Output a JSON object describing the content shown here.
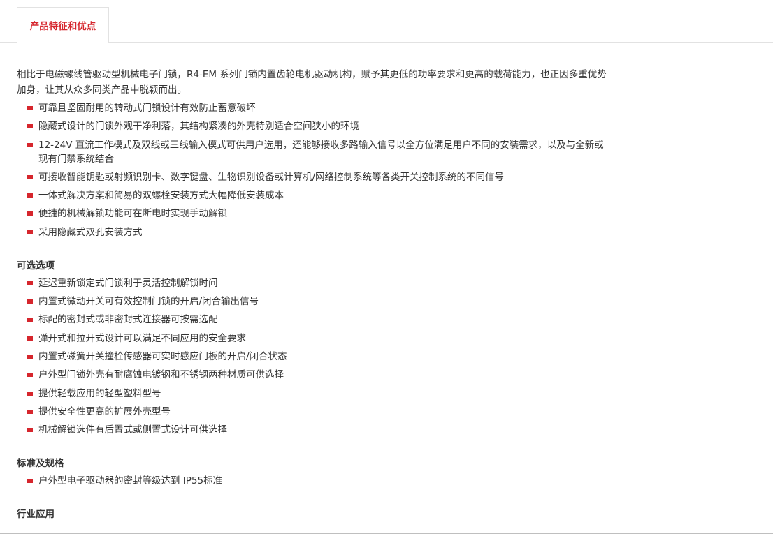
{
  "tabs": [
    {
      "label": "产品特征和优点"
    }
  ],
  "intro": "相比于电磁螺线管驱动型机械电子门锁，R4-EM 系列门锁内置齿轮电机驱动机构，赋予其更低的功率要求和更高的载荷能力，也正因多重优势加身，让其从众多同类产品中脱颖而出。",
  "features": [
    "可靠且坚固耐用的转动式门锁设计有效防止蓄意破坏",
    "隐藏式设计的门锁外观干净利落，其结构紧凑的外壳特别适合空间狭小的环境",
    "12-24V 直流工作模式及双线或三线输入模式可供用户选用，还能够接收多路输入信号以全方位满足用户不同的安装需求，以及与全新或现有门禁系统结合",
    "可接收智能钥匙或射频识别卡、数字键盘、生物识别设备或计算机/网络控制系统等各类开关控制系统的不同信号",
    "一体式解决方案和简易的双螺栓安装方式大幅降低安装成本",
    "便捷的机械解锁功能可在断电时实现手动解锁",
    "采用隐藏式双孔安装方式"
  ],
  "options": {
    "heading": "可选选项",
    "items": [
      "延迟重新锁定式门锁利于灵活控制解锁时间",
      "内置式微动开关可有效控制门锁的开启/闭合输出信号",
      "标配的密封式或非密封式连接器可按需选配",
      "弹开式和拉开式设计可以满足不同应用的安全要求",
      "内置式磁簧开关撞栓传感器可实时感应门板的开启/闭合状态",
      "户外型门锁外壳有耐腐蚀电镀钢和不锈钢两种材质可供选择",
      "提供轻载应用的轻型塑料型号",
      "提供安全性更高的扩展外壳型号",
      "机械解锁选件有后置式或侧置式设计可供选择"
    ]
  },
  "standards": {
    "heading": "标准及规格",
    "items": [
      "户外型电子驱动器的密封等级达到 IP55标准"
    ]
  },
  "applications": {
    "heading": "行业应用"
  },
  "colors": {
    "accent": "#d6262d",
    "text": "#333333",
    "border": "#e2e2e2"
  }
}
